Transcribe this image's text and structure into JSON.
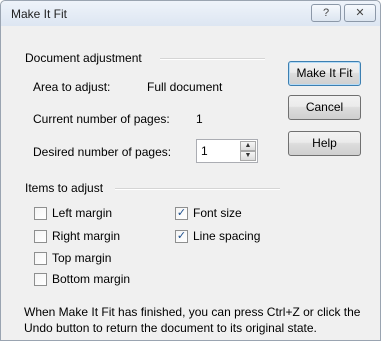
{
  "window": {
    "title": "Make It Fit",
    "help_glyph": "?",
    "close_glyph": "✕"
  },
  "document_adjustment": {
    "group_label": "Document adjustment",
    "area_label": "Area to adjust:",
    "area_value": "Full document",
    "current_pages_label": "Current number of pages:",
    "current_pages_value": "1",
    "desired_pages_label": "Desired number of pages:",
    "desired_pages_value": "1"
  },
  "buttons": {
    "make_it_fit": "Make It Fit",
    "cancel": "Cancel",
    "help": "Help"
  },
  "items_to_adjust": {
    "group_label": "Items to adjust",
    "left_margin": {
      "label": "Left margin",
      "checked": false
    },
    "right_margin": {
      "label": "Right margin",
      "checked": false
    },
    "top_margin": {
      "label": "Top margin",
      "checked": false
    },
    "bottom_margin": {
      "label": "Bottom margin",
      "checked": false
    },
    "font_size": {
      "label": "Font size",
      "checked": true
    },
    "line_spacing": {
      "label": "Line spacing",
      "checked": true
    }
  },
  "note": "When Make It Fit has finished, you can press Ctrl+Z or click the Undo button to return the document to its original state.",
  "icons": {
    "check": "✓",
    "spin_up": "▲",
    "spin_down": "▼"
  }
}
